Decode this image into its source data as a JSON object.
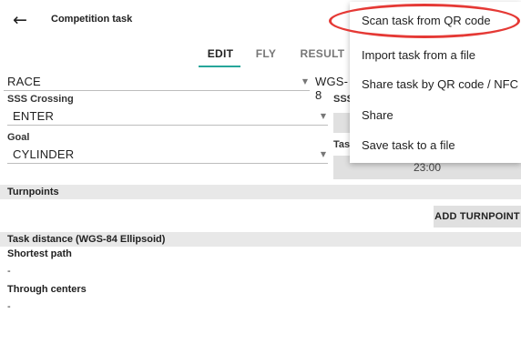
{
  "appbar": {
    "title": "Competition task",
    "back_icon": "←"
  },
  "tabs": [
    {
      "label": "EDIT",
      "active": true
    },
    {
      "label": "FLY",
      "active": false
    },
    {
      "label": "RESULT",
      "active": false
    }
  ],
  "form": {
    "task_type": "RACE",
    "geoid_partial": "WGS-8",
    "sss_crossing_label": "SSS Crossing",
    "sss_crossing_value": "ENTER",
    "sss_right_label_partial": "SSS",
    "goal_label": "Goal",
    "goal_value": "CYLINDER",
    "task_deadline_label_partial": "Tasl",
    "task_deadline_value": "23:00"
  },
  "turnpoints": {
    "header": "Turnpoints",
    "add_button": "ADD TURNPOINT"
  },
  "distance": {
    "header": "Task distance (WGS-84 Ellipsoid)",
    "shortest_label": "Shortest path",
    "shortest_value": "-",
    "centers_label": "Through centers",
    "centers_value": "-"
  },
  "menu": {
    "items": [
      "Scan task from QR code",
      "Import task from a file",
      "Share task by QR code / NFC",
      "Share",
      "Save task to a file"
    ]
  },
  "colors": {
    "accent": "#26a69a",
    "highlight": "#e53935"
  }
}
